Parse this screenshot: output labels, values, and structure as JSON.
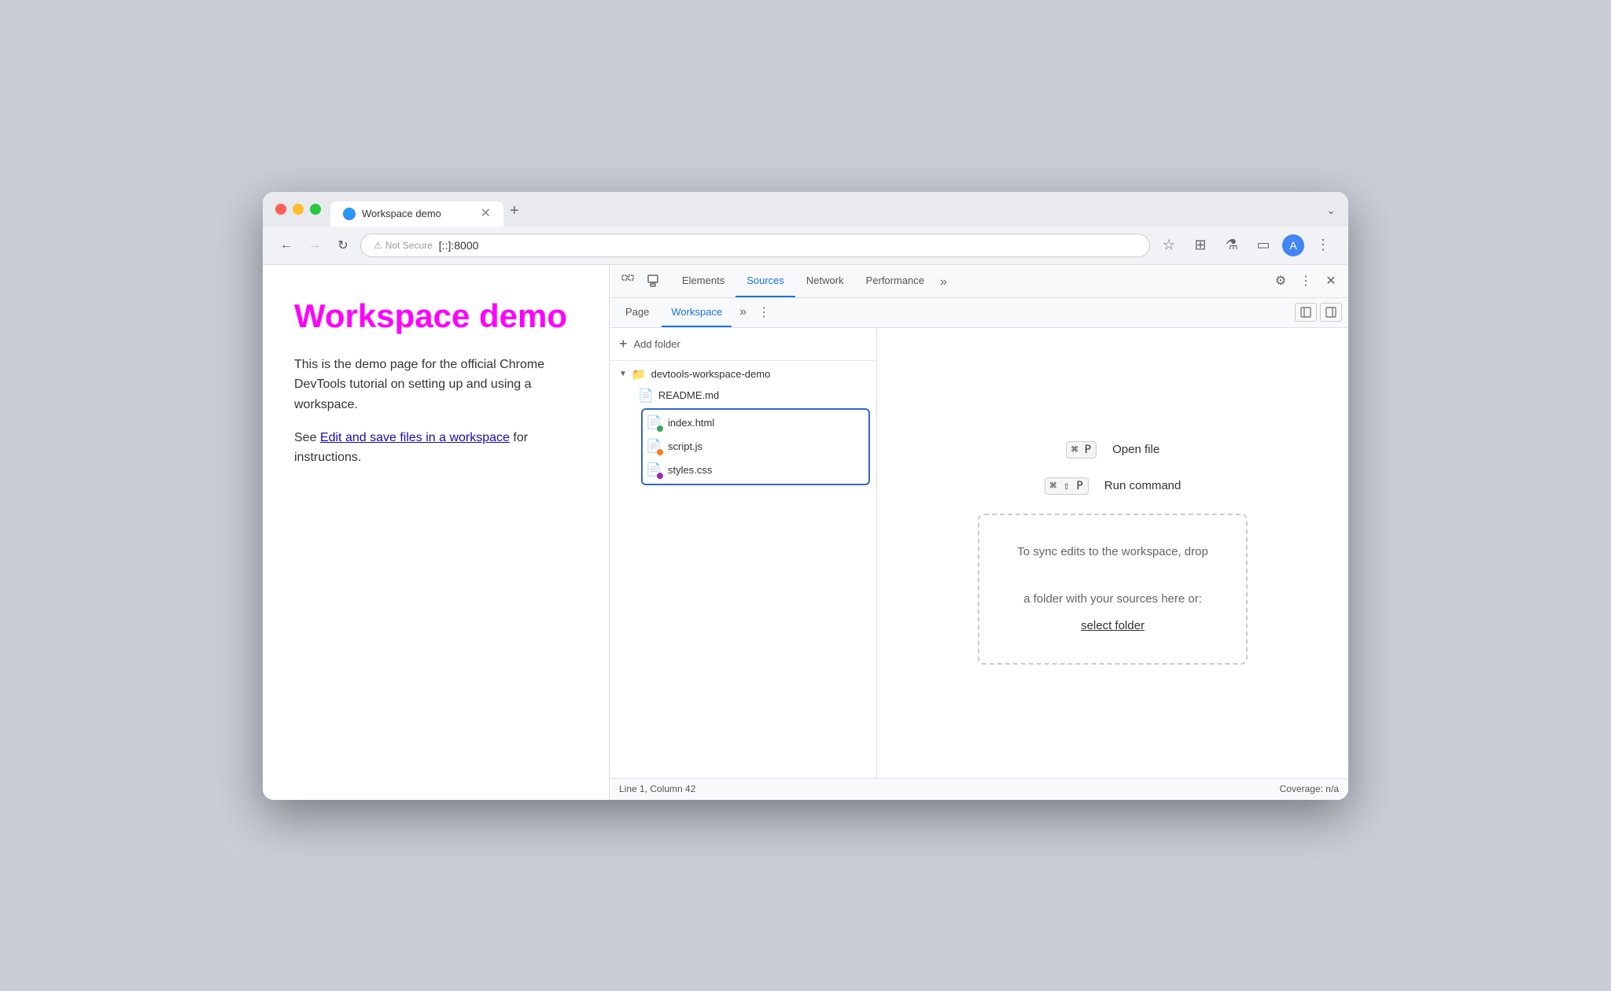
{
  "browser": {
    "tab": {
      "title": "Workspace demo",
      "favicon": "🌐"
    },
    "new_tab_label": "+",
    "tab_expand_label": "⌄",
    "address": {
      "not_secure_label": "Not Secure",
      "url": "[::]:8000",
      "warning_icon": "⚠"
    },
    "toolbar": {
      "back": "←",
      "forward": "→",
      "reload": "↻",
      "bookmark": "☆",
      "extensions": "🧩",
      "devtools_toggle": "🔬",
      "account": "👤",
      "menu": "⋮"
    }
  },
  "page": {
    "title": "Workspace demo",
    "description": "This is the demo page for the official Chrome DevTools tutorial on setting up and using a workspace.",
    "link_text": "Edit and save files in a workspace",
    "link_suffix": " for instructions.",
    "see_prefix": "See "
  },
  "devtools": {
    "tabs": [
      {
        "id": "elements",
        "label": "Elements",
        "active": false
      },
      {
        "id": "sources",
        "label": "Sources",
        "active": true
      },
      {
        "id": "network",
        "label": "Network",
        "active": false
      },
      {
        "id": "performance",
        "label": "Performance",
        "active": false
      },
      {
        "id": "more",
        "label": "»",
        "active": false
      }
    ],
    "tools": {
      "inspect_icon": "⬚",
      "device_icon": "⬜"
    },
    "settings_icon": "⚙",
    "more_icon": "⋮",
    "close_icon": "✕",
    "collapse_right_icon": "⊣",
    "sub_tabs": [
      {
        "id": "page",
        "label": "Page",
        "active": false
      },
      {
        "id": "workspace",
        "label": "Workspace",
        "active": true
      }
    ],
    "sub_more": "»",
    "sub_menu": "⋮",
    "collapse_sidebar": "⊢",
    "file_tree": {
      "add_folder": "+ Add folder",
      "root": {
        "name": "devtools-workspace-demo",
        "expanded": true,
        "children": [
          {
            "id": "readme",
            "name": "README.md",
            "dot": null,
            "type": "file"
          },
          {
            "id": "index",
            "name": "index.html",
            "dot": "green",
            "type": "file",
            "highlighted": true
          },
          {
            "id": "script",
            "name": "script.js",
            "dot": "orange",
            "type": "file",
            "highlighted": true
          },
          {
            "id": "styles",
            "name": "styles.css",
            "dot": "purple",
            "type": "file",
            "highlighted": true
          }
        ]
      }
    },
    "editor": {
      "shortcut1": {
        "keys": "⌘ P",
        "label": "Open file"
      },
      "shortcut2": {
        "keys": "⌘ ⇧ P",
        "label": "Run command"
      },
      "drop_zone_text": "To sync edits to the workspace, drop\n\na folder with your sources here or:",
      "select_folder": "select folder"
    },
    "status": {
      "position": "Line 1, Column 42",
      "coverage": "Coverage: n/a"
    }
  }
}
